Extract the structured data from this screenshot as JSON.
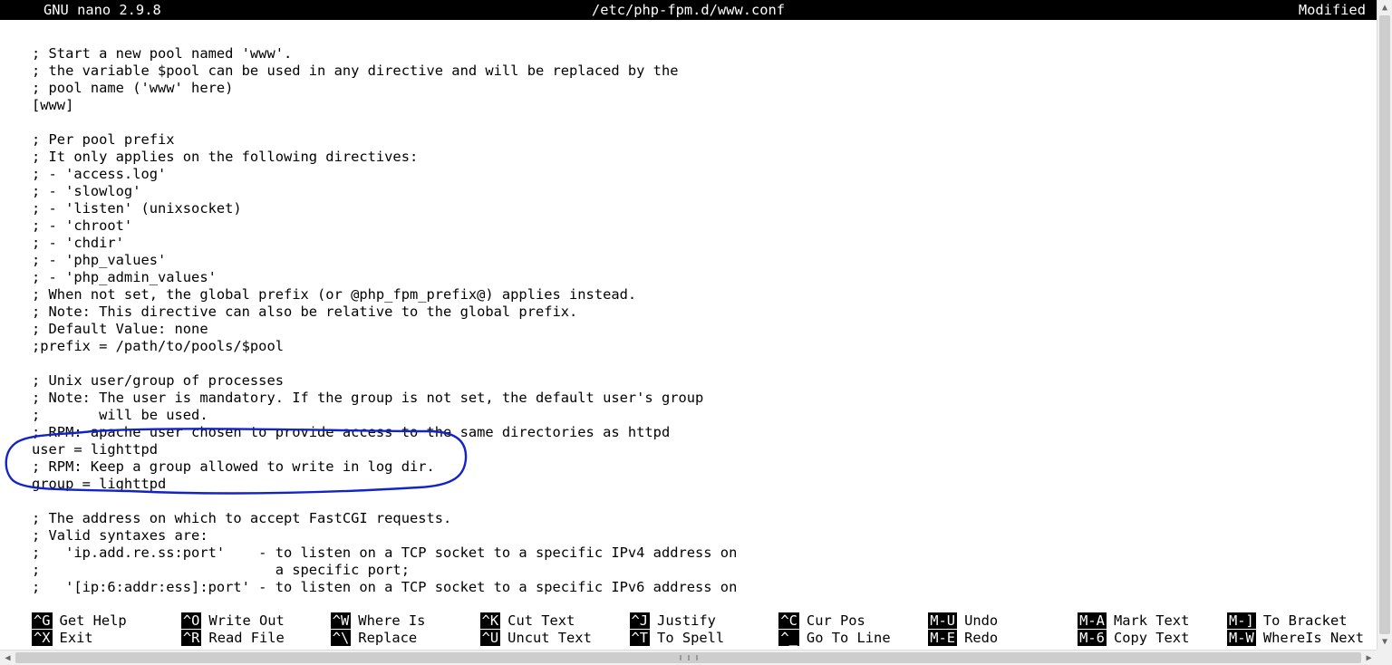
{
  "titlebar": {
    "app": "GNU nano 2.9.8",
    "file": "/etc/php-fpm.d/www.conf",
    "status": "Modified"
  },
  "lines": [
    "",
    "; Start a new pool named 'www'.",
    "; the variable $pool can be used in any directive and will be replaced by the",
    "; pool name ('www' here)",
    "[www]",
    "",
    "; Per pool prefix",
    "; It only applies on the following directives:",
    "; - 'access.log'",
    "; - 'slowlog'",
    "; - 'listen' (unixsocket)",
    "; - 'chroot'",
    "; - 'chdir'",
    "; - 'php_values'",
    "; - 'php_admin_values'",
    "; When not set, the global prefix (or @php_fpm_prefix@) applies instead.",
    "; Note: This directive can also be relative to the global prefix.",
    "; Default Value: none",
    ";prefix = /path/to/pools/$pool",
    "",
    "; Unix user/group of processes",
    "; Note: The user is mandatory. If the group is not set, the default user's group",
    ";       will be used.",
    "; RPM: apache user chosen to provide access to the same directories as httpd",
    "user = lighttpd",
    "; RPM: Keep a group allowed to write in log dir.",
    "group = lighttpd",
    "",
    "; The address on which to accept FastCGI requests.",
    "; Valid syntaxes are:",
    ";   'ip.add.re.ss:port'    - to listen on a TCP socket to a specific IPv4 address on",
    ";                            a specific port;",
    ";   '[ip:6:addr:ess]:port' - to listen on a TCP socket to a specific IPv6 address on"
  ],
  "shortcuts": [
    {
      "key": "^G",
      "label": "Get Help"
    },
    {
      "key": "^O",
      "label": "Write Out"
    },
    {
      "key": "^W",
      "label": "Where Is"
    },
    {
      "key": "^K",
      "label": "Cut Text"
    },
    {
      "key": "^J",
      "label": "Justify"
    },
    {
      "key": "^C",
      "label": "Cur Pos"
    },
    {
      "key": "M-U",
      "label": "Undo"
    },
    {
      "key": "M-A",
      "label": "Mark Text"
    },
    {
      "key": "M-]",
      "label": "To Bracket"
    },
    {
      "key": "^X",
      "label": "Exit"
    },
    {
      "key": "^R",
      "label": "Read File"
    },
    {
      "key": "^\\",
      "label": "Replace"
    },
    {
      "key": "^U",
      "label": "Uncut Text"
    },
    {
      "key": "^T",
      "label": "To Spell"
    },
    {
      "key": "^_",
      "label": "Go To Line"
    },
    {
      "key": "M-E",
      "label": "Redo"
    },
    {
      "key": "M-6",
      "label": "Copy Text"
    },
    {
      "key": "M-W",
      "label": "WhereIs Next"
    }
  ],
  "annotation": {
    "stroke": "#1224c7",
    "highlighted_lines": [
      "user = lighttpd",
      "; RPM: Keep a group allowed to write in log dir.",
      "group = lighttpd"
    ]
  }
}
